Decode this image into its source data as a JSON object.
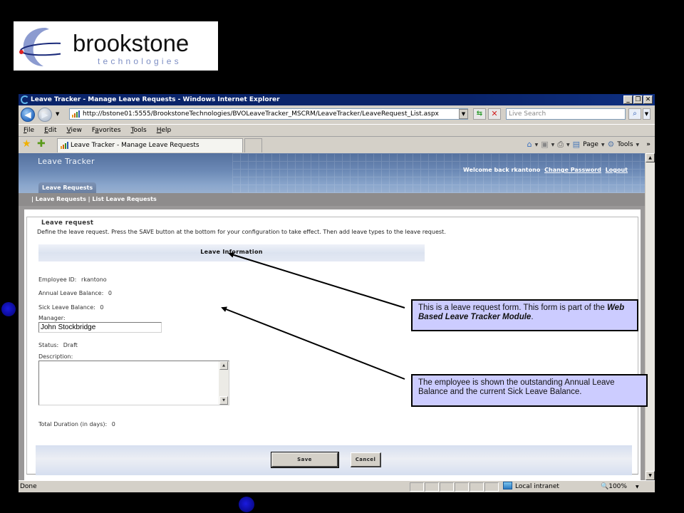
{
  "logo": {
    "brand": "brookstone",
    "tagline": "technologies"
  },
  "browser": {
    "window_title": "Leave Tracker - Manage Leave Requests - Windows Internet Explorer",
    "window_buttons": [
      "_",
      "❐",
      "✕"
    ],
    "url": "http://bstone01:5555/BrookstoneTechnologies/BVOLeaveTracker_MSCRM/LeaveTracker/LeaveRequest_List.aspx",
    "search_placeholder": "Live Search",
    "menu": [
      "File",
      "Edit",
      "View",
      "Favorites",
      "Tools",
      "Help"
    ],
    "menu_access_keys": [
      "F",
      "E",
      "V",
      "a",
      "T",
      "H"
    ],
    "active_tab": "Leave Tracker - Manage Leave Requests",
    "command_bar": {
      "page_label": "Page",
      "tools_label": "Tools",
      "overflow": "»"
    },
    "status": {
      "text": "Done",
      "zone": "Local intranet",
      "zoom": "100%"
    }
  },
  "app": {
    "title": "Leave Tracker",
    "welcome_text": "Welcome back rkantono",
    "change_password": "Change Password",
    "logout": "Logout",
    "tab": "Leave Requests",
    "subnav": {
      "separator": "|",
      "items": [
        "Leave Requests",
        "List Leave Requests"
      ]
    },
    "form": {
      "legend": "Leave request",
      "intro": "Define the leave request. Press the SAVE button at the bottom for your configuration to take effect. Then add leave types to the leave request.",
      "section_header": "Leave Information",
      "employee_id_label": "Employee ID:",
      "employee_id": "rkantono",
      "annual_leave_label": "Annual Leave Balance:",
      "annual_leave": "0",
      "sick_leave_label": "Sick Leave Balance:",
      "sick_leave": "0",
      "manager_label": "Manager:",
      "manager_value": "John Stockbridge",
      "status_label": "Status:",
      "status_value": "Draft",
      "description_label": "Description:",
      "description_value": "",
      "total_duration_label": "Total Duration (in days):",
      "total_duration": "0",
      "save_label": "Save",
      "cancel_label": "Cancel"
    }
  },
  "callouts": [
    {
      "text_before": "This is a leave request form. This form is part of the ",
      "emphasis": "Web Based Leave Tracker Module",
      "text_after": "."
    },
    {
      "text": "The employee is shown the outstanding Annual Leave Balance and the current Sick Leave Balance."
    }
  ],
  "colors": {
    "titlebar": "#0a246a",
    "callout_bg": "#ccccff",
    "header_blue": "#6c8ab6",
    "subnav_gray": "#8e8c8c",
    "bullet_blue": "#1a1ae0"
  }
}
